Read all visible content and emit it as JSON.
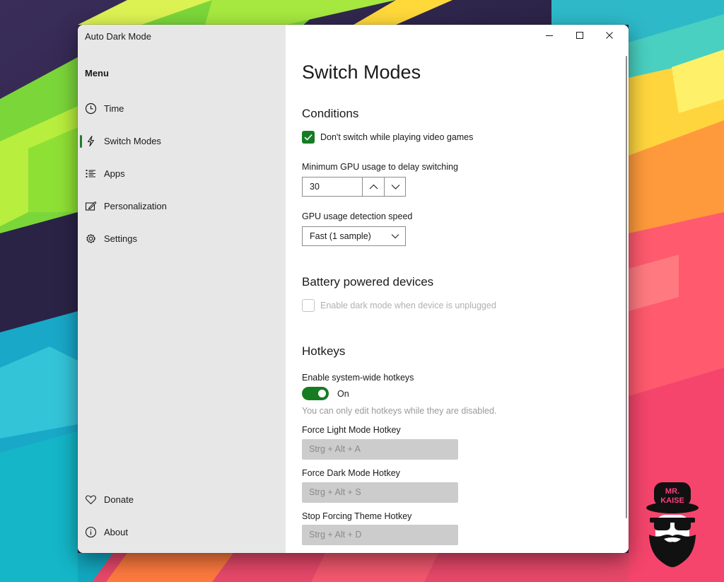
{
  "app": {
    "title": "Auto Dark Mode"
  },
  "sidebar": {
    "menu_label": "Menu",
    "items": [
      {
        "label": "Time",
        "icon": "clock-icon"
      },
      {
        "label": "Switch Modes",
        "icon": "lightning-icon",
        "selected": true
      },
      {
        "label": "Apps",
        "icon": "list-icon"
      },
      {
        "label": "Personalization",
        "icon": "paint-icon"
      },
      {
        "label": "Settings",
        "icon": "gear-icon"
      }
    ],
    "footer_items": [
      {
        "label": "Donate",
        "icon": "heart-icon"
      },
      {
        "label": "About",
        "icon": "info-icon"
      }
    ]
  },
  "page": {
    "title": "Switch Modes",
    "conditions": {
      "title": "Conditions",
      "video_games_checkbox": {
        "label": "Don't switch while playing video games",
        "checked": true
      },
      "gpu_usage": {
        "label": "Minimum GPU usage to delay switching",
        "value": "30"
      },
      "detection_speed": {
        "label": "GPU usage detection speed",
        "value": "Fast (1 sample)"
      }
    },
    "battery": {
      "title": "Battery powered devices",
      "unplugged_checkbox": {
        "label": "Enable dark mode when device is unplugged",
        "checked": false,
        "disabled": true
      }
    },
    "hotkeys": {
      "title": "Hotkeys",
      "enable_label": "Enable system-wide hotkeys",
      "toggle_state": "On",
      "toggle_on": true,
      "hint": "You can only edit hotkeys while they are disabled.",
      "light": {
        "label": "Force Light Mode Hotkey",
        "value": "Strg + Alt + A"
      },
      "dark": {
        "label": "Force Dark Mode Hotkey",
        "value": "Strg + Alt + S"
      },
      "stop": {
        "label": "Stop Forcing Theme Hotkey",
        "value": "Strg + Alt + D"
      }
    }
  },
  "watermark": {
    "line1": "MR.",
    "line2": "KAISE"
  },
  "colors": {
    "accent": "#167c22",
    "sidebar_bg": "#e7e7e7",
    "hotkey_bg": "#cccccc"
  }
}
